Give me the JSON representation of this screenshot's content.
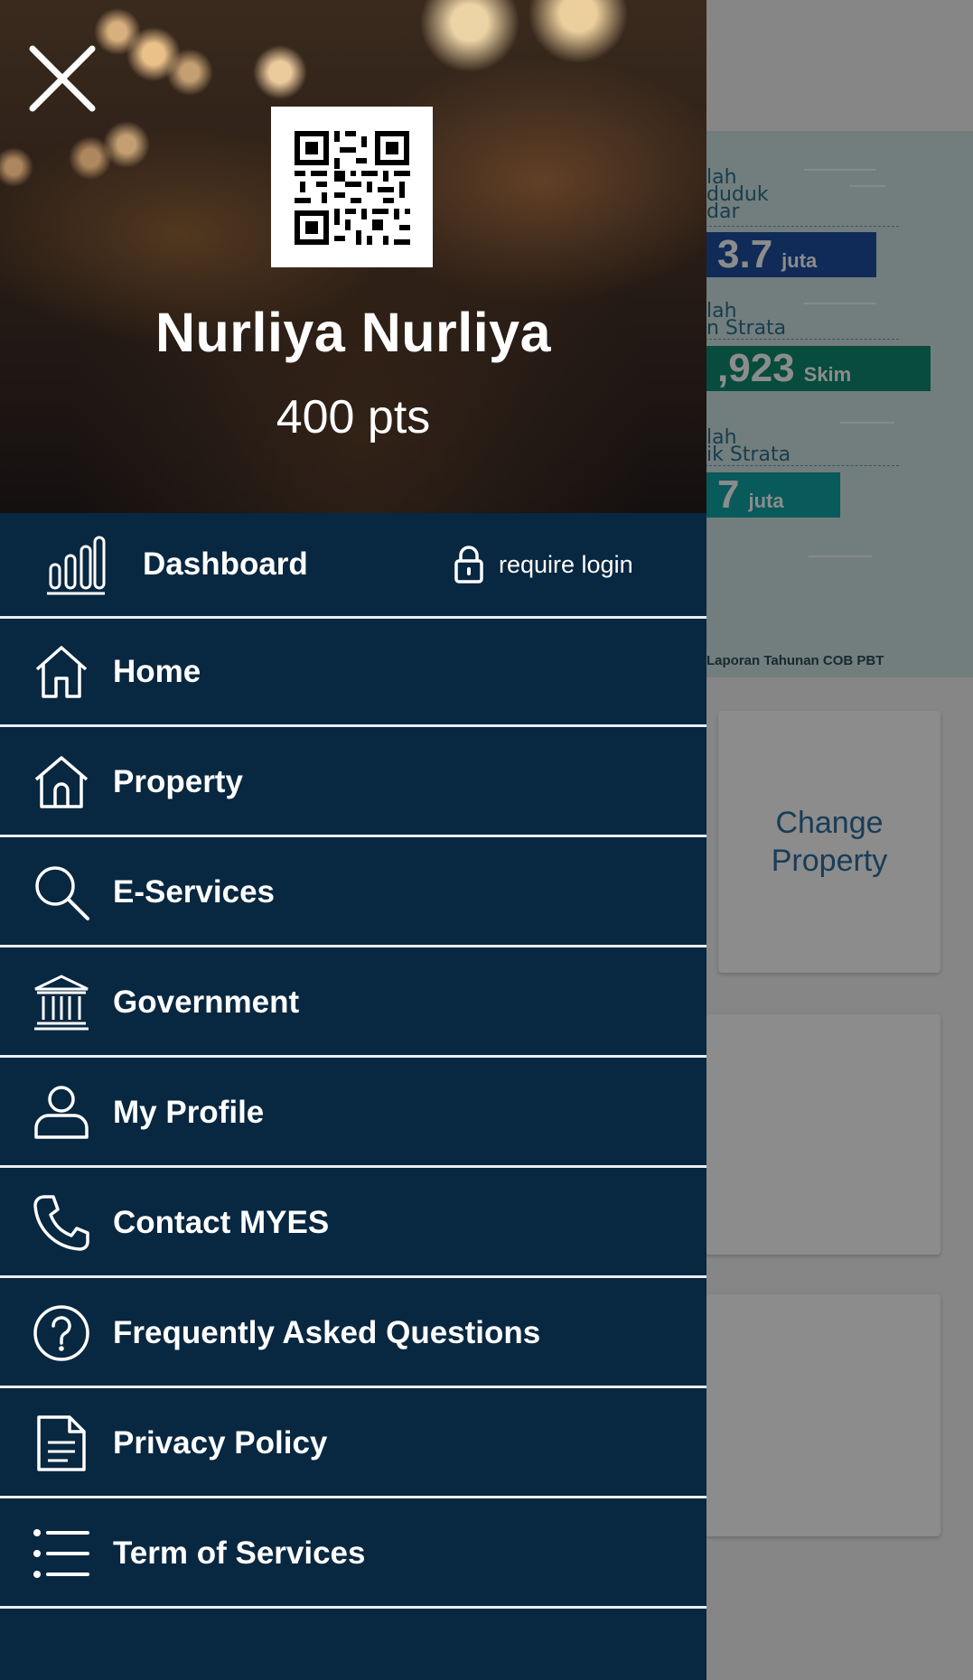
{
  "background_app": {
    "banner": {
      "labels": [
        "lah\nduduk\ndar",
        "lah\nn Strata",
        "lah\nik Strata"
      ],
      "values": [
        {
          "number": "3.7",
          "unit": "juta",
          "color": "#1e4fa0"
        },
        {
          "number": ",923",
          "unit": "Skim",
          "color": "#0e8a6f"
        },
        {
          "number": "7",
          "unit": "juta",
          "color": "#12a4a4"
        }
      ],
      "footer": "Laporan Tahunan COB PBT"
    },
    "change_property_label": "Change Property"
  },
  "drawer": {
    "close_icon": "close-icon",
    "qr_icon": "qr-code",
    "user_name": "Nurliya Nurliya",
    "points": "400 pts",
    "dashboard": {
      "label": "Dashboard",
      "icon": "bar-chart-icon",
      "lock_note": "require login",
      "lock_icon": "lock-icon"
    },
    "menu_items": [
      {
        "label": "Home",
        "icon": "home-icon"
      },
      {
        "label": "Property",
        "icon": "property-icon"
      },
      {
        "label": "E-Services",
        "icon": "search-icon"
      },
      {
        "label": "Government",
        "icon": "government-icon"
      },
      {
        "label": "My Profile",
        "icon": "profile-icon"
      },
      {
        "label": "Contact MYES",
        "icon": "phone-icon"
      },
      {
        "label": "Frequently Asked Questions",
        "icon": "question-icon"
      },
      {
        "label": "Privacy Policy",
        "icon": "document-icon"
      },
      {
        "label": "Term of Services",
        "icon": "list-icon"
      }
    ]
  },
  "colors": {
    "drawer_bg": "#082740",
    "divider": "#e9eef2",
    "accent_link": "#2d6f9f"
  }
}
